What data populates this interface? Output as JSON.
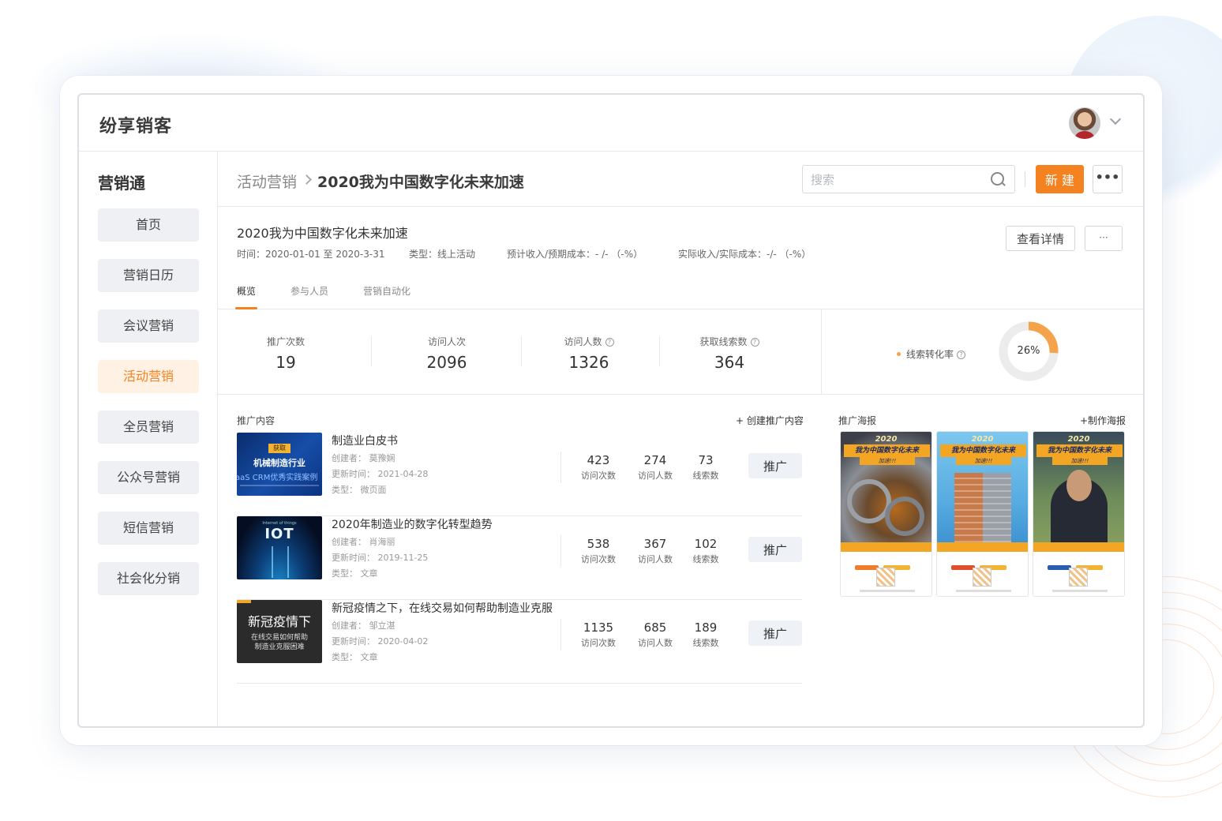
{
  "app": {
    "brand": "纷享销客"
  },
  "sidebar": {
    "title": "营销通",
    "items": [
      {
        "label": "首页",
        "active": false
      },
      {
        "label": "营销日历",
        "active": false
      },
      {
        "label": "会议营销",
        "active": false
      },
      {
        "label": "活动营销",
        "active": true
      },
      {
        "label": "全员营销",
        "active": false
      },
      {
        "label": "公众号营销",
        "active": false
      },
      {
        "label": "短信营销",
        "active": false
      },
      {
        "label": "社会化分销",
        "active": false
      }
    ]
  },
  "header": {
    "breadcrumb_parent": "活动营销",
    "breadcrumb_current": "2020我为中国数字化未来加速",
    "search_placeholder": "搜索",
    "new_label": "新 建",
    "more_label": "•••"
  },
  "campaign": {
    "title": "2020我为中国数字化未来加速",
    "meta_time": "时间：2020-01-01 至 2020-3-31",
    "meta_type": "类型：线上活动",
    "meta_expected": "预计收入/预期成本：- /- （-%）",
    "meta_actual": "实际收入/实际成本：-/- （-%）",
    "detail_label": "查看详情",
    "detail_more_label": "···",
    "tabs": [
      {
        "label": "概览",
        "active": true
      },
      {
        "label": "参与人员",
        "active": false
      },
      {
        "label": "营销自动化",
        "active": false
      }
    ]
  },
  "stats": [
    {
      "label": "推广次数",
      "value": "19",
      "help": false
    },
    {
      "label": "访问人次",
      "value": "2096",
      "help": false
    },
    {
      "label": "访问人数",
      "value": "1326",
      "help": true
    },
    {
      "label": "获取线索数",
      "value": "364",
      "help": true
    }
  ],
  "conversion": {
    "label": "线索转化率",
    "value_text": "26%",
    "fraction": 0.26,
    "color": "#f5a34a",
    "track_color": "#ececec"
  },
  "content": {
    "title": "推广内容",
    "action": "+ 创建推广内容",
    "items": [
      {
        "title": "制造业白皮书",
        "creator": "创建者： 莫豫娴",
        "updated": "更新时间： 2021-04-28",
        "type": "类型： 微页面",
        "visits": "423",
        "visitors": "274",
        "leads": "73",
        "thumb": {
          "badge": "获取",
          "line1": "机械制造行业",
          "line2": "aaS CRM优秀实践案例"
        }
      },
      {
        "title": "2020年制造业的数字化转型趋势",
        "creator": "创建者： 肖海丽",
        "updated": "更新时间： 2019-11-25",
        "type": "类型： 文章",
        "visits": "538",
        "visitors": "367",
        "leads": "102",
        "thumb": {
          "line1": "Internet of things",
          "line2": "IOT"
        }
      },
      {
        "title": "新冠疫情之下，在线交易如何帮助制造业克服",
        "creator": "创建者： 邹立湛",
        "updated": "更新时间： 2020-04-02",
        "type": "类型： 文章",
        "visits": "1135",
        "visitors": "685",
        "leads": "189",
        "thumb": {
          "line1": "新冠疫情下",
          "line2": "在线交易如何帮助",
          "line3": "制造业克服困难"
        }
      }
    ],
    "labels": {
      "visits": "访问次数",
      "visitors": "访问人数",
      "leads": "线索数",
      "promote": "推广"
    }
  },
  "posters": {
    "title": "推广海报",
    "action": "+制作海报",
    "items": [
      {
        "year": "2020",
        "title": "我为中国数字化未来",
        "sub": "加速!!!"
      },
      {
        "year": "2020",
        "title": "我为中国数字化未来",
        "sub": "加速!!!"
      },
      {
        "year": "2020",
        "title": "我为中国数字化未来",
        "sub": "加速!!!"
      }
    ]
  },
  "colors": {
    "accent": "#f58220",
    "active_bg": "#fff1e4"
  }
}
